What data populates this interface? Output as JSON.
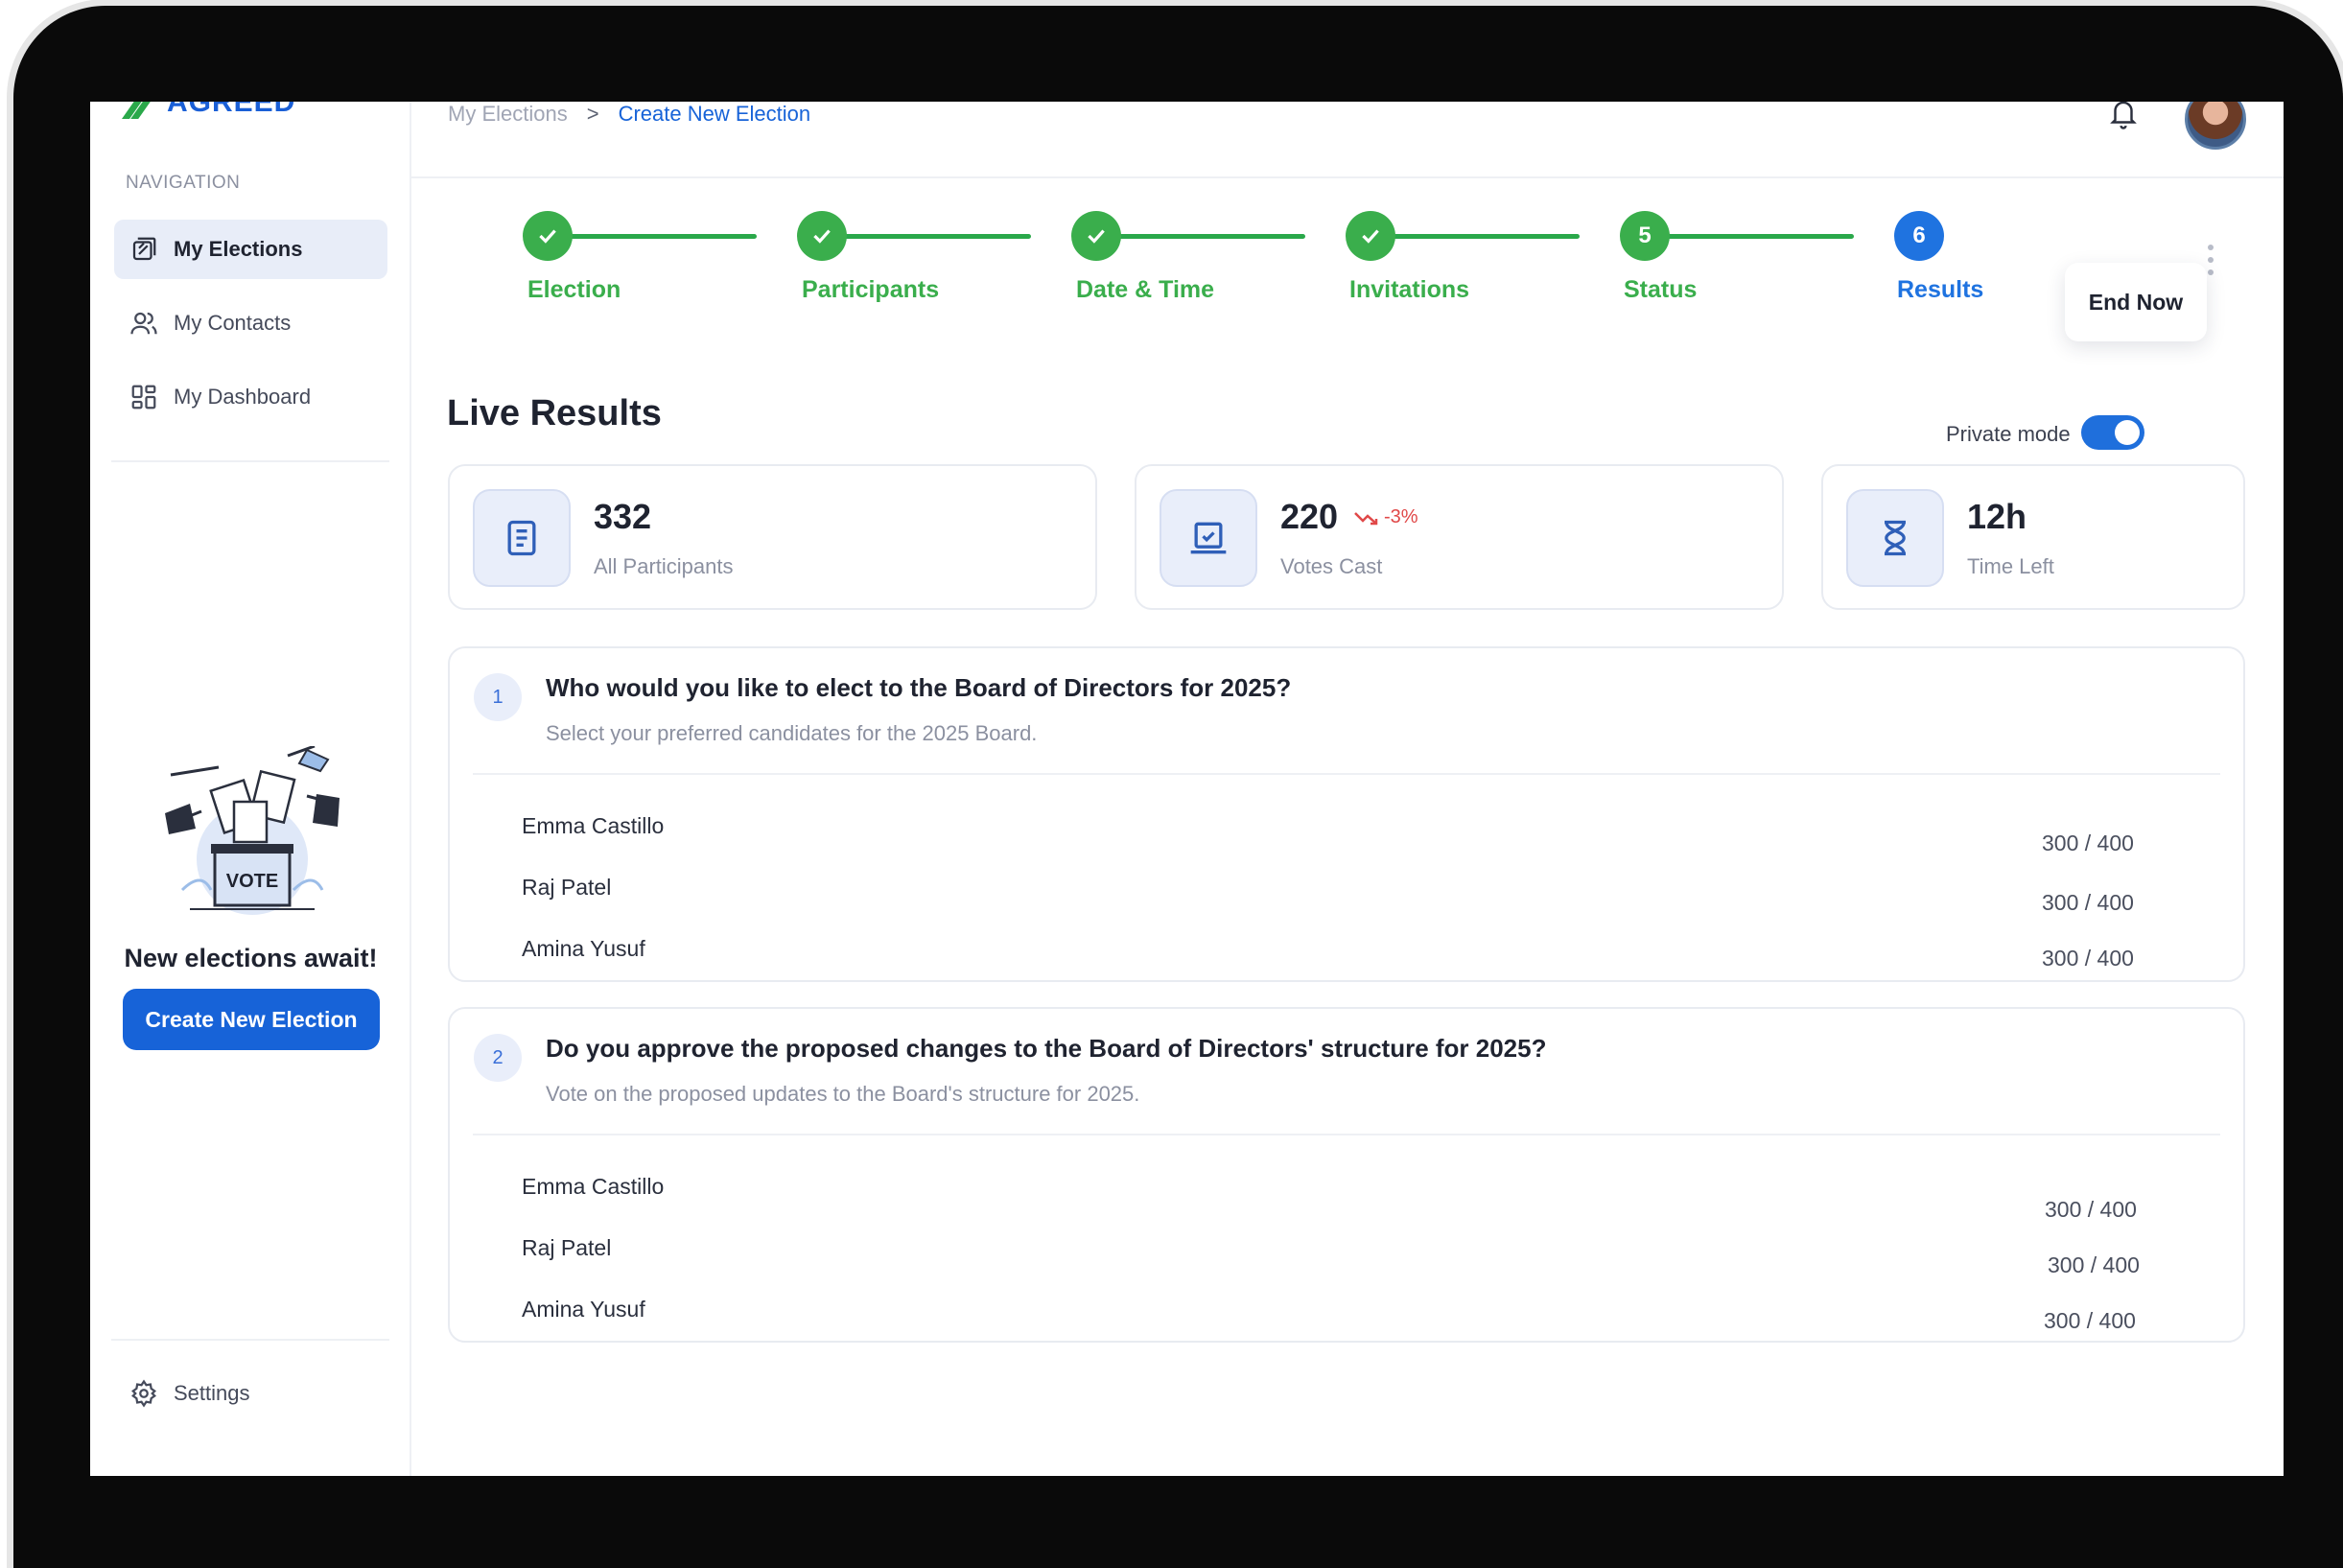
{
  "app": {
    "logo_text": "AGREED"
  },
  "sidebar": {
    "heading": "NAVIGATION",
    "items": [
      {
        "label": "My Elections",
        "icon": "elections-icon",
        "active": true
      },
      {
        "label": "My Contacts",
        "icon": "contacts-icon",
        "active": false
      },
      {
        "label": "My Dashboard",
        "icon": "dashboard-icon",
        "active": false
      }
    ],
    "promo": {
      "title": "New elections await!",
      "button": "Create New Election",
      "art_text": "VOTE"
    },
    "settings_label": "Settings"
  },
  "breadcrumb": {
    "root": "My Elections",
    "separator": ">",
    "current": "Create New Election"
  },
  "stepper": {
    "steps": [
      {
        "label": "Election",
        "state": "done"
      },
      {
        "label": "Participants",
        "state": "done"
      },
      {
        "label": "Date & Time",
        "state": "done"
      },
      {
        "label": "Invitations",
        "state": "done"
      },
      {
        "label": "Status",
        "state": "done",
        "number": "5"
      },
      {
        "label": "Results",
        "state": "current",
        "number": "6"
      }
    ],
    "end_button": "End Now"
  },
  "results": {
    "title": "Live Results",
    "private_mode_label": "Private mode",
    "private_mode_on": true,
    "stats": [
      {
        "value": "332",
        "label": "All Participants",
        "icon": "document-icon"
      },
      {
        "value": "220",
        "label": "Votes Cast",
        "trend": "-3%",
        "icon": "ballot-icon"
      },
      {
        "value": "12h",
        "label": "Time Left",
        "icon": "hourglass-icon"
      }
    ]
  },
  "questions": [
    {
      "number": "1",
      "title": "Who would you like to elect to the Board of Directors for 2025?",
      "subtitle": "Select your preferred candidates for the 2025 Board.",
      "candidates": [
        {
          "name": "Emma Castillo",
          "score": "300 / 400"
        },
        {
          "name": "Raj Patel",
          "score": "300 / 400"
        },
        {
          "name": "Amina Yusuf",
          "score": "300 / 400"
        }
      ]
    },
    {
      "number": "2",
      "title": "Do you approve the proposed changes to the Board of Directors' structure for 2025?",
      "subtitle": "Vote on the proposed updates to the Board's structure for 2025.",
      "candidates": [
        {
          "name": "Emma Castillo",
          "score": "300 / 400"
        },
        {
          "name": "Raj Patel",
          "score": "300 / 400"
        },
        {
          "name": "Amina Yusuf",
          "score": "300 / 400"
        }
      ]
    }
  ],
  "colors": {
    "accent": "#1763d8",
    "success": "#3aae4c",
    "danger": "#e04848"
  }
}
